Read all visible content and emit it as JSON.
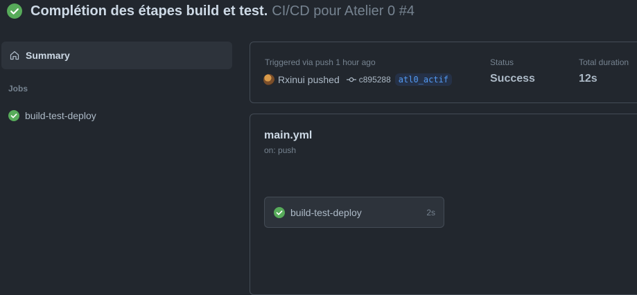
{
  "run": {
    "title": "Complétion des étapes build et test.",
    "subtitle": "CI/CD pour Atelier 0 #4",
    "status_icon": "check-circle-fill-icon"
  },
  "sidebar": {
    "summary_label": "Summary",
    "jobs_heading": "Jobs",
    "jobs": [
      {
        "label": "build-test-deploy",
        "icon": "check-circle-fill-icon"
      }
    ]
  },
  "summary": {
    "triggered": "Triggered via push 1 hour ago",
    "pusher": "Rxinui pushed",
    "commit_sha": "c895288",
    "branch": "atl0_actif",
    "status_label": "Status",
    "status_value": "Success",
    "duration_label": "Total duration",
    "duration_value": "12s"
  },
  "workflow": {
    "name": "main.yml",
    "trigger": "on: push",
    "job": {
      "label": "build-test-deploy",
      "duration": "2s"
    }
  },
  "colors": {
    "background": "#22272e",
    "success": "#57ab5a",
    "link": "#539bf5"
  }
}
